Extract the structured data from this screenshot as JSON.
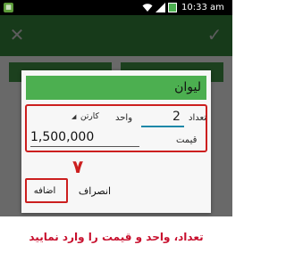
{
  "status_bar": {
    "time": "10:33 am",
    "icons": [
      "notification-icon",
      "wifi-icon",
      "signal-icon",
      "battery-icon"
    ]
  },
  "app_bar": {
    "close_icon": "close-icon",
    "confirm_icon": "check-icon",
    "color": "#33813a"
  },
  "dialog": {
    "product_name": "ليوان",
    "quantity_label": "تعداد",
    "quantity_value": "2",
    "unit_label": "واحد",
    "unit_value": "كارتن",
    "price_label": "قيمت",
    "price_value": "1,500,000",
    "cancel_label": "انصراف",
    "add_label": "اضافه",
    "step_number": "٧"
  },
  "caption": "تعداد، واحد و قیمت را وارد نمایید",
  "colors": {
    "accent_red": "#cc1f1f",
    "header_green": "#4caf50",
    "input_underline": "#1e88a8"
  }
}
